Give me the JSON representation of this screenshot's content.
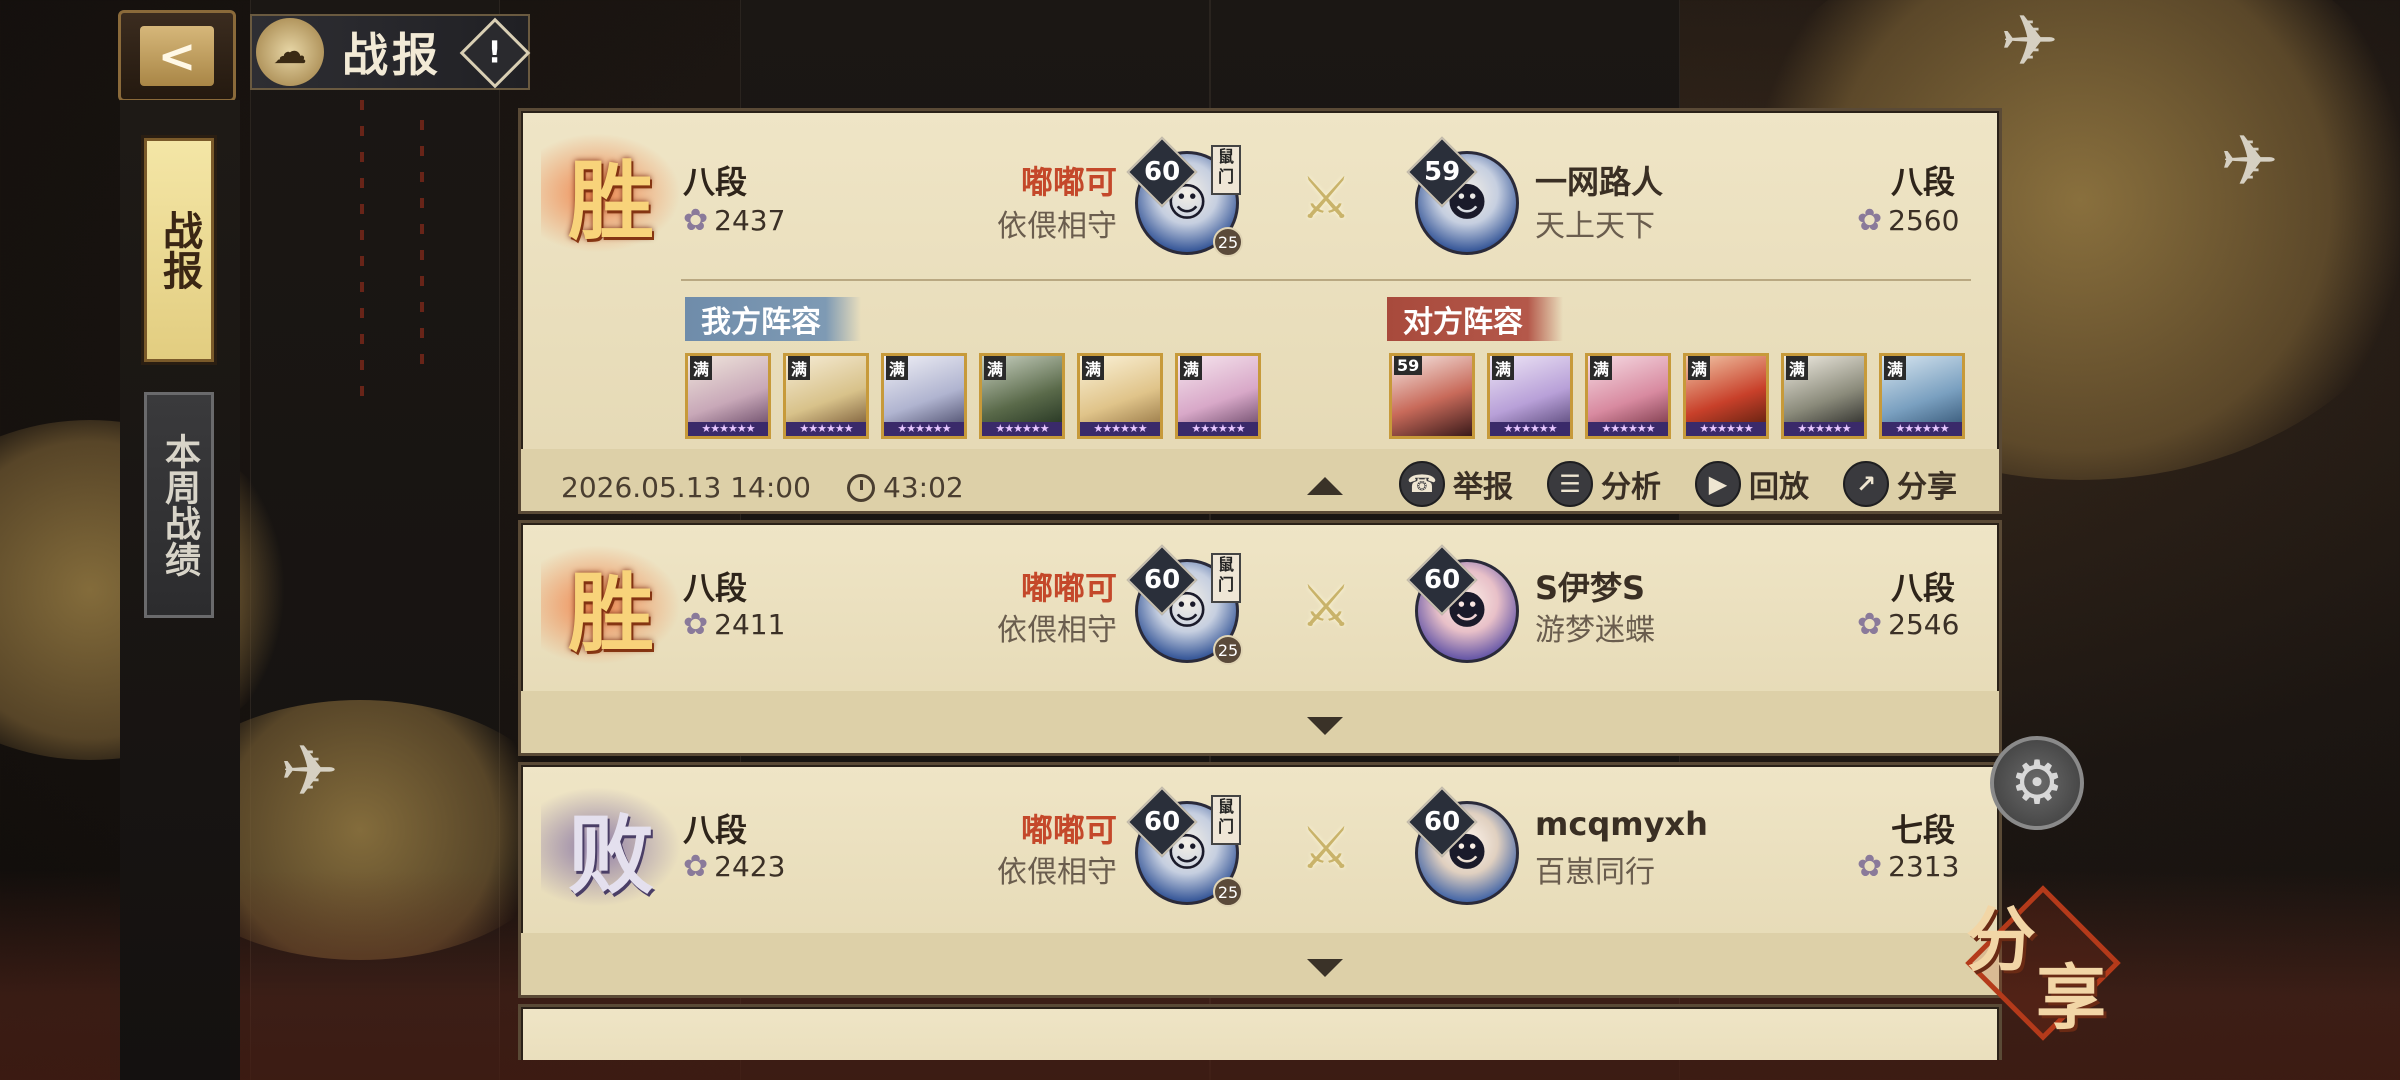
{
  "header": {
    "title": "战报",
    "back_icon": "back-arrow-icon",
    "info_label": "!"
  },
  "tabs": [
    {
      "label": "战报",
      "active": true
    },
    {
      "label": "本周战绩",
      "active": false
    }
  ],
  "battles": [
    {
      "result": "胜",
      "my_rank": "八段",
      "my_score": "2437",
      "my_name": "嘟嘟可",
      "my_guild": "依偎相守",
      "my_level": "60",
      "my_tag": "鼠门",
      "my_sub": "25",
      "opp_level": "59",
      "opp_name": "一网路人",
      "opp_guild": "天上天下",
      "opp_rank": "八段",
      "opp_score": "2560",
      "expanded": true,
      "my_team_label": "我方阵容",
      "opp_team_label": "对方阵容",
      "my_team": [
        "满",
        "满",
        "满",
        "满",
        "满",
        "满"
      ],
      "opp_team": [
        "59",
        "满",
        "满",
        "满",
        "满",
        "满"
      ],
      "date": "2026.05.13 14:00",
      "duration": "43:02",
      "actions": [
        {
          "label": "举报",
          "icon": "report-icon"
        },
        {
          "label": "分析",
          "icon": "analysis-icon"
        },
        {
          "label": "回放",
          "icon": "replay-icon"
        },
        {
          "label": "分享",
          "icon": "share-icon"
        }
      ]
    },
    {
      "result": "胜",
      "my_rank": "八段",
      "my_score": "2411",
      "my_name": "嘟嘟可",
      "my_guild": "依偎相守",
      "my_level": "60",
      "my_tag": "鼠门",
      "my_sub": "25",
      "opp_level": "60",
      "opp_name": "S伊梦S",
      "opp_guild": "游梦迷蝶",
      "opp_rank": "八段",
      "opp_score": "2546",
      "expanded": false
    },
    {
      "result": "败",
      "my_rank": "八段",
      "my_score": "2423",
      "my_name": "嘟嘟可",
      "my_guild": "依偎相守",
      "my_level": "60",
      "my_tag": "鼠门",
      "my_sub": "25",
      "opp_level": "60",
      "opp_name": "mcqmyxh",
      "opp_guild": "百崽同行",
      "opp_rank": "七段",
      "opp_score": "2313",
      "expanded": false
    }
  ],
  "floating": {
    "settings_icon": "gear-icon",
    "share_big_1": "分",
    "share_big_2": "享"
  },
  "colors": {
    "win": "#f8d37a",
    "lose": "#e4e0ee",
    "my_name": "#c4482a",
    "my_team": "#7e9ab4",
    "opp_team": "#b4584a"
  }
}
